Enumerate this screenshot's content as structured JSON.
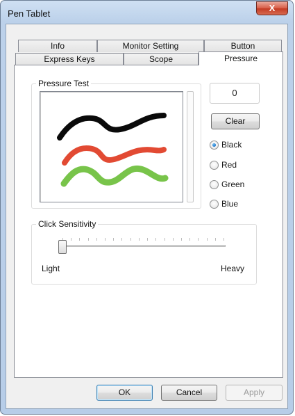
{
  "window": {
    "title": "Pen Tablet",
    "close_glyph": "X"
  },
  "tabs": {
    "back_row": [
      "Info",
      "Monitor Setting",
      "Button"
    ],
    "front_row": [
      "Express Keys",
      "Scope",
      "Pressure"
    ],
    "active": "Pressure"
  },
  "pressure_test": {
    "group_label": "Pressure Test",
    "value": "0",
    "clear_label": "Clear",
    "strokes": [
      {
        "color_name": "Black",
        "hex": "#0a0a0a"
      },
      {
        "color_name": "Red",
        "hex": "#e24a33"
      },
      {
        "color_name": "Green",
        "hex": "#78c44a"
      }
    ],
    "colors": [
      {
        "label": "Black",
        "checked": true
      },
      {
        "label": "Red",
        "checked": false
      },
      {
        "label": "Green",
        "checked": false
      },
      {
        "label": "Blue",
        "checked": false
      }
    ]
  },
  "click_sensitivity": {
    "group_label": "Click Sensitivity",
    "min_label": "Light",
    "max_label": "Heavy",
    "tick_count": 20,
    "level": 0
  },
  "buttons": {
    "ok": "OK",
    "cancel": "Cancel",
    "apply": "Apply"
  }
}
